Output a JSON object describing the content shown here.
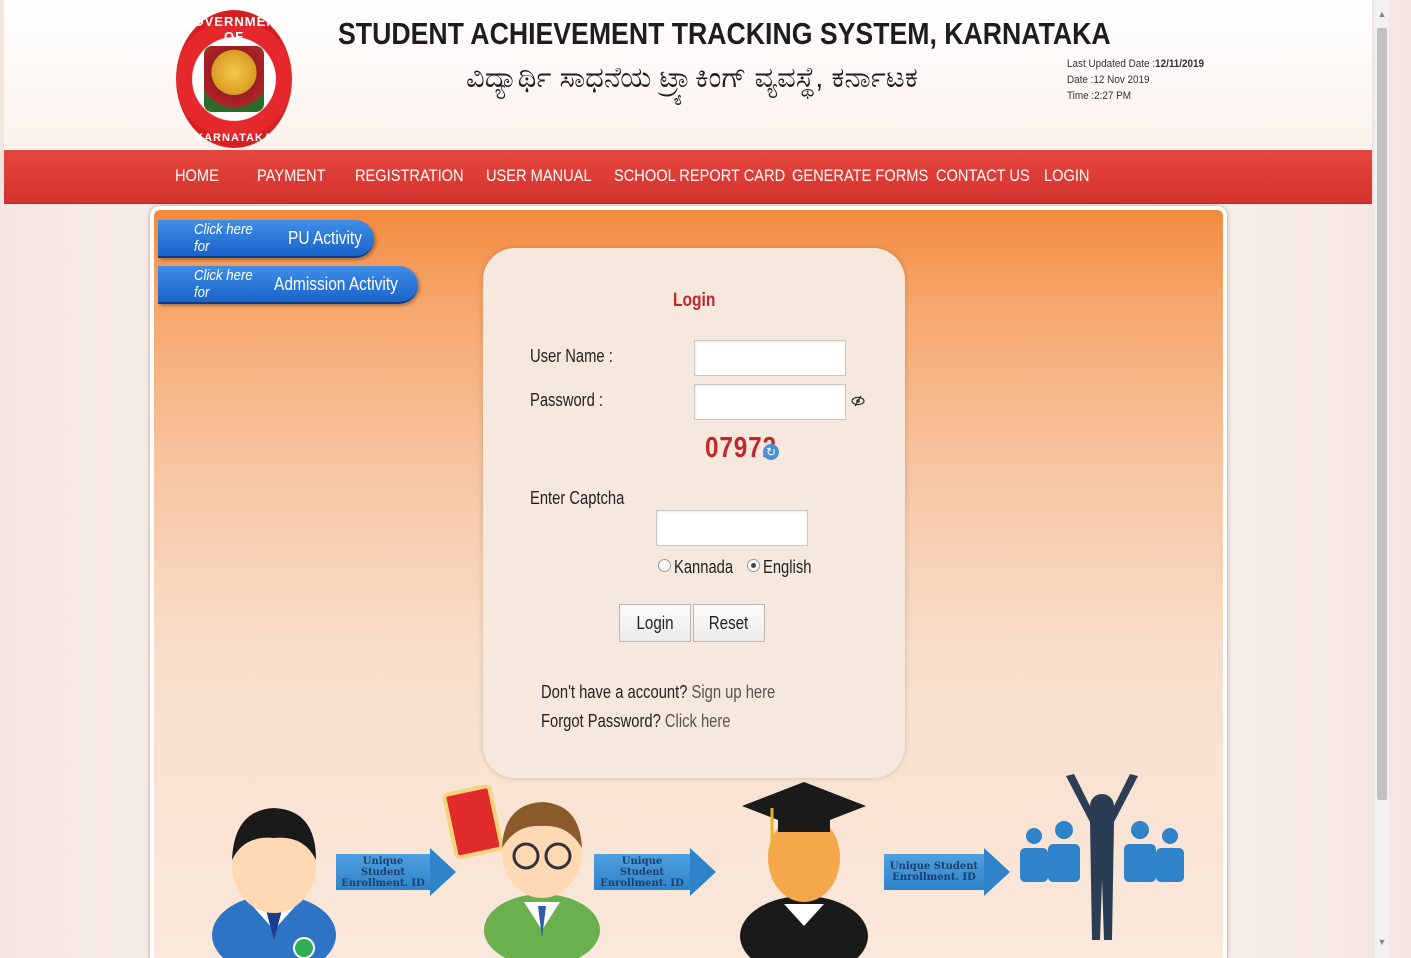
{
  "header": {
    "emblem_top_text": "GOVERNMENT OF",
    "emblem_bottom_text": "KARNATAKA",
    "title_en": "STUDENT ACHIEVEMENT TRACKING SYSTEM, KARNATAKA",
    "title_kn": "ವಿದ್ಯಾರ್ಥಿ ಸಾಧನೆಯ ಟ್ರ್ಯಾಕಿಂಗ್ ವ್ಯವಸ್ಥೆ, ಕರ್ನಾಟಕ",
    "last_updated_label": "Last Updated Date :",
    "last_updated_value": "12/11/2019",
    "date_line": "Date :12 Nov 2019",
    "time_line": "Time :2:27 PM"
  },
  "nav": {
    "home": "HOME",
    "payment": "PAYMENT",
    "registration": "REGISTRATION",
    "user_manual": "USER MANUAL",
    "school_report_card": "SCHOOL REPORT CARD",
    "generate_forms": "GENERATE FORMS",
    "contact_us": "CONTACT US",
    "login": "LOGIN"
  },
  "side_links": {
    "click_here": "Click here for",
    "pu_activity": "PU Activity",
    "admission_activity": "Admission Activity"
  },
  "login": {
    "title": "Login",
    "username_label": "User Name :",
    "username_value": "",
    "password_label": "Password :",
    "password_value": "",
    "eye_icon": "eye-slash",
    "captcha_code": "07972",
    "captcha_label": "Enter Captcha",
    "captcha_value": "",
    "lang_kannada": "Kannada",
    "lang_english": "English",
    "selected_language": "English",
    "login_button": "Login",
    "reset_button": "Reset",
    "no_account_text": "Don't have a account?",
    "signup_link": "Sign up here",
    "forgot_text": "Forgot Password?",
    "forgot_link": "Click here"
  },
  "illustration": {
    "arrow_label_line1": "Unique Student",
    "arrow_label_line2": "Enrollment. ID"
  },
  "colors": {
    "nav_red": "#dc3a35",
    "accent_blue": "#1a64c9",
    "login_title_red": "#c0282d",
    "captcha_red": "#c4272b"
  }
}
